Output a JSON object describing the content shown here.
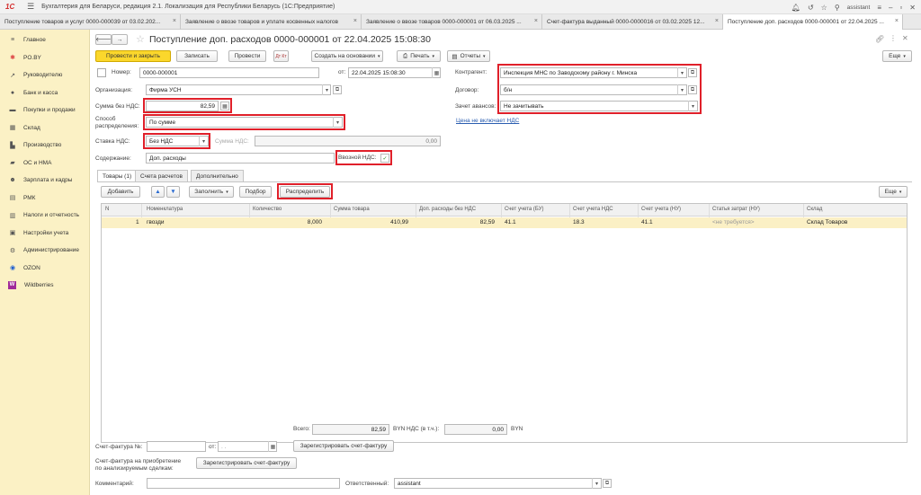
{
  "app": {
    "logo": "1С",
    "title": "Бухгалтерия для Беларуси, редакция 2.1. Локализация для Республики Беларусь  (1С:Предприятие)",
    "user": "assistant"
  },
  "tabs": [
    {
      "label": "Поступление товаров и услуг 0000-000039 от 03.02.202..."
    },
    {
      "label": "Заявление о ввозе товаров и уплате косвенных налогов"
    },
    {
      "label": "Заявление о ввозе товаров 0000-000001 от 06.03.2025 ..."
    },
    {
      "label": "Счет-фактура выданный 0000-0000016 от 03.02.2025 12..."
    },
    {
      "label": "Поступление доп. расходов 0000-000001 от 22.04.2025 ..."
    }
  ],
  "sidebar": {
    "items": [
      {
        "label": "Главное",
        "icon": "hamburger-icon"
      },
      {
        "label": "PO.BY",
        "icon": "star-icon"
      },
      {
        "label": "Руководителю",
        "icon": "chart-line-icon"
      },
      {
        "label": "Банк и касса",
        "icon": "coin-icon"
      },
      {
        "label": "Покупки и продажи",
        "icon": "cart-icon"
      },
      {
        "label": "Склад",
        "icon": "warehouse-icon"
      },
      {
        "label": "Производство",
        "icon": "factory-icon"
      },
      {
        "label": "ОС и НМА",
        "icon": "truck-icon"
      },
      {
        "label": "Зарплата и кадры",
        "icon": "people-icon"
      },
      {
        "label": "РМК",
        "icon": "register-icon"
      },
      {
        "label": "Налоги и отчетность",
        "icon": "report-icon"
      },
      {
        "label": "Настройки учета",
        "icon": "settings-book-icon"
      },
      {
        "label": "Администрирование",
        "icon": "gear-icon"
      },
      {
        "label": "OZON",
        "icon": "ozon-icon"
      },
      {
        "label": "Wildberries",
        "icon": "wildberries-icon"
      }
    ]
  },
  "doc": {
    "title": "Поступление доп. расходов 0000-000001 от 22.04.2025 15:08:30",
    "toolbar": {
      "post_close": "Провести и закрыть",
      "save": "Записать",
      "post": "Провести",
      "dt_kt": "Дт Кт",
      "create_based": "Создать на основании",
      "print": "Печать",
      "reports": "Отчеты",
      "more": "Еще"
    },
    "fields": {
      "number_label": "Номер:",
      "number": "0000-000001",
      "date_label": "от:",
      "date": "22.04.2025 15:08:30",
      "org_label": "Организация:",
      "org": "Фирма УСН",
      "sum_label": "Сумма без НДС:",
      "sum": "82,59",
      "method_label_1": "Способ",
      "method_label_2": "распределения:",
      "method": "По сумме",
      "vat_rate_label": "Ставка НДС:",
      "vat_rate": "Без НДС",
      "vat_sum_label": "Сумма НДС:",
      "vat_sum": "0,00",
      "content_label": "Содержание:",
      "content": "Доп. расходы",
      "import_vat_label": "Ввозной НДС:",
      "counterparty_label": "Контрагент:",
      "counterparty": "Инспекция МНС по Заводскому району г. Минска",
      "contract_label": "Договор:",
      "contract": "б/н",
      "advance_label": "Зачет авансов:",
      "advance": "Не зачитывать",
      "price_link": "Цена не включает НДС"
    },
    "inner_tabs": [
      "Товары (1)",
      "Счета расчетов",
      "Дополнительно"
    ],
    "table_toolbar": {
      "add": "Добавить",
      "fill": "Заполнить",
      "pick": "Подбор",
      "distribute": "Распределить",
      "more": "Еще"
    },
    "columns": [
      "N",
      "Номенклатура",
      "Количество",
      "Сумма товара",
      "Доп. расходы без НДС",
      "Счет учета (БУ)",
      "Счет учета НДС",
      "Счет учета (НУ)",
      "Статья затрат (НУ)",
      "Склад"
    ],
    "rows": [
      {
        "n": "1",
        "item": "гвозди",
        "qty": "8,000",
        "sum": "410,99",
        "extra": "82,59",
        "acc_bu": "41.1",
        "acc_vat": "18.3",
        "acc_nu": "41.1",
        "cost_item": "<не требуется>",
        "warehouse": "Склад Товаров"
      }
    ],
    "footer": {
      "total_label": "Всего:",
      "total": "82,59",
      "currency": "BYN",
      "vat_label": "НДС (в т.ч.):",
      "vat": "0,00",
      "currency2": "BYN",
      "invoice_label": "Счет-фактура №:",
      "invoice_from": "от:",
      "invoice_date_placeholder": ". .",
      "register_invoice": "Зарегистрировать счет-фактуру",
      "invoice2_label_1": "Счет-фактура на приобретение",
      "invoice2_label_2": "по анализируемым сделкам:",
      "register_invoice2": "Зарегистрировать счет-фактуру",
      "comment_label": "Комментарий:",
      "responsible_label": "Ответственный:",
      "responsible": "assistant"
    }
  },
  "colors": {
    "accent_yellow": "#fbd72c",
    "sidebar_bg": "#fbf1c5",
    "highlight_red": "#e0202a",
    "row_selected": "#fbf0c5"
  }
}
